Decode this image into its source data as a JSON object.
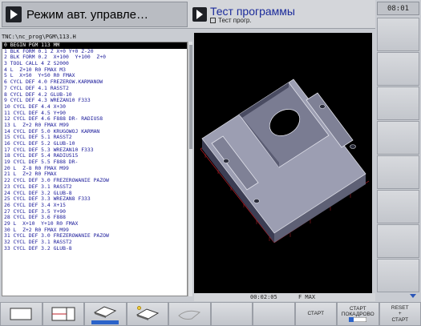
{
  "header": {
    "mode_title": "Режим авт. управле…",
    "program_title": "Тест программы",
    "program_subtitle": "Тест прогр."
  },
  "clock": "08:01",
  "program": {
    "path": "TNC:\\nc_prog\\PGM\\113.H",
    "lines": [
      {
        "num": "0",
        "code": " BEGIN PGM 113 MM",
        "selected": true
      },
      {
        "num": "1",
        "code": " BLK FORM 0.1 Z X+0 Y+0 Z-20"
      },
      {
        "num": "2",
        "code": " BLK FORM 0.2  X+100  Y+100  Z+0"
      },
      {
        "num": "3",
        "code": " TOOL CALL 4 Z S2000"
      },
      {
        "num": "4",
        "code": " L  Z+10 R0 FMAX M3"
      },
      {
        "num": "5",
        "code": " L  X+50  Y+50 R0 FMAX"
      },
      {
        "num": "6",
        "code": " CYCL DEF 4.0 FREZEROW.KARMANOW"
      },
      {
        "num": "7",
        "code": " CYCL DEF 4.1 RASST2"
      },
      {
        "num": "8",
        "code": " CYCL DEF 4.2 GLUB-10"
      },
      {
        "num": "9",
        "code": " CYCL DEF 4.3 WREZAN10 F333"
      },
      {
        "num": "10",
        "code": " CYCL DEF 4.4 X+30"
      },
      {
        "num": "11",
        "code": " CYCL DEF 4.5 Y+90"
      },
      {
        "num": "12",
        "code": " CYCL DEF 4.6 F888 DR- RADIUS8"
      },
      {
        "num": "13",
        "code": " L  Z+2 R0 FMAX M99"
      },
      {
        "num": "14",
        "code": " CYCL DEF 5.0 KRUGOWOJ KARMAN"
      },
      {
        "num": "15",
        "code": " CYCL DEF 5.1 RASST2"
      },
      {
        "num": "16",
        "code": " CYCL DEF 5.2 GLUB-10"
      },
      {
        "num": "17",
        "code": " CYCL DEF 5.3 WREZAN10 F333"
      },
      {
        "num": "18",
        "code": " CYCL DEF 5.4 RADIUS15"
      },
      {
        "num": "19",
        "code": " CYCL DEF 5.5 F888 DR-"
      },
      {
        "num": "20",
        "code": " L  Z-8 R0 FMAX M99"
      },
      {
        "num": "21",
        "code": " L  Z+2 R0 FMAX"
      },
      {
        "num": "22",
        "code": " CYCL DEF 3.0 FREZEROWANIE PAZOW"
      },
      {
        "num": "23",
        "code": " CYCL DEF 3.1 RASST2"
      },
      {
        "num": "24",
        "code": " CYCL DEF 3.2 GLUB-8"
      },
      {
        "num": "25",
        "code": " CYCL DEF 3.3 WREZAN8 F333"
      },
      {
        "num": "26",
        "code": " CYCL DEF 3.4 X+15"
      },
      {
        "num": "27",
        "code": " CYCL DEF 3.5 Y+90"
      },
      {
        "num": "28",
        "code": " CYCL DEF 3.6 F888"
      },
      {
        "num": "29",
        "code": " L  X+10  Y+10 R0 FMAX"
      },
      {
        "num": "30",
        "code": " L  Z+2 R0 FMAX M99"
      },
      {
        "num": "31",
        "code": " CYCL DEF 3.0 FREZEROWANIE PAZOW"
      },
      {
        "num": "32",
        "code": " CYCL DEF 3.1 RASST2"
      },
      {
        "num": "33",
        "code": " CYCL DEF 3.2 GLUB-8"
      }
    ]
  },
  "status": {
    "time": "00:02:05",
    "feed": "F MAX"
  },
  "softkeys": {
    "start": "СТАРТ",
    "start_block_line1": "СТАРТ",
    "start_block_line2": "ПОКАДРОВО",
    "reset_line1": "RESET",
    "reset_line2": "+",
    "reset_line3": "СТАРТ"
  },
  "colors": {
    "code_text": "#1a1a9a",
    "selection": "#000000",
    "accent": "#2b63c9"
  },
  "icons": {
    "mode": "play-icon",
    "program": "play-icon",
    "view": "3d-view-icon"
  }
}
